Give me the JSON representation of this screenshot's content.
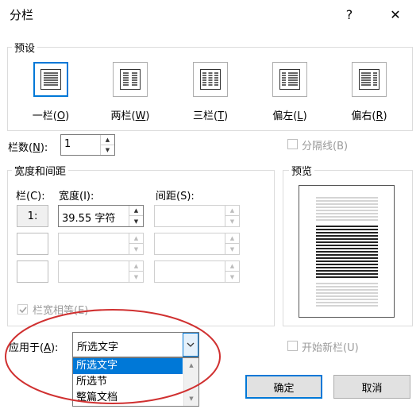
{
  "window": {
    "title": "分栏",
    "help_icon": "?",
    "close_icon": "✕"
  },
  "presets": {
    "label": "预设",
    "items": [
      {
        "label": "一栏(",
        "key": "O",
        "suffix": ")"
      },
      {
        "label": "两栏(",
        "key": "W",
        "suffix": ")"
      },
      {
        "label": "三栏(",
        "key": "T",
        "suffix": ")"
      },
      {
        "label": "偏左(",
        "key": "L",
        "suffix": ")"
      },
      {
        "label": "偏右(",
        "key": "R",
        "suffix": ")"
      }
    ]
  },
  "columns_count": {
    "label": "栏数(",
    "key": "N",
    "suffix": "):",
    "value": "1"
  },
  "separator": {
    "label": "分隔线(B)"
  },
  "width_spacing": {
    "label": "宽度和间距",
    "col_header": "栏(C):",
    "width_header": "宽度(I):",
    "spacing_header": "间距(S):",
    "rows": [
      {
        "num": "1:",
        "width": "39.55 字符",
        "spacing": ""
      },
      {
        "num": "",
        "width": "",
        "spacing": ""
      },
      {
        "num": "",
        "width": "",
        "spacing": ""
      }
    ],
    "equal_width": "栏宽相等(E)"
  },
  "preview": {
    "label": "预览"
  },
  "apply_to": {
    "label": "应用于(",
    "key": "A",
    "suffix": "):",
    "value": "所选文字",
    "options": [
      "所选文字",
      "所选节",
      "整篇文档"
    ]
  },
  "new_column": {
    "label": "开始新栏(U)"
  },
  "buttons": {
    "ok": "确定",
    "cancel": "取消"
  },
  "colors": {
    "accent": "#0078d7",
    "annotation": "#d03030"
  }
}
